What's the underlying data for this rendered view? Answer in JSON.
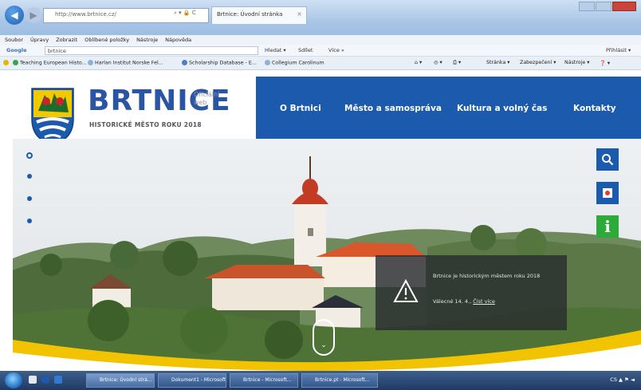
{
  "browser": {
    "address": "http://www.brtnice.cz/",
    "address_controls": "⌕ ▾ 🔒 C",
    "tab_title": "Brtnice: Úvodní stránka",
    "tab_close": "×",
    "menu": [
      "Soubor",
      "Úpravy",
      "Zobrazit",
      "Oblíbené položky",
      "Nástroje",
      "Nápověda"
    ],
    "google": {
      "logo": "Google",
      "query": "brtnice",
      "buttons": [
        "Hledat ▾",
        "Sdílet",
        "Více »"
      ],
      "signin": "Přihlásit ▾"
    },
    "favorites": [
      "Teaching European Histo...",
      "Harlan Institut Norske Fel...",
      "Scholarship Database - E...",
      "Collegium Carolinum"
    ],
    "commands": [
      "Stránka ▾",
      "Zabezpečení ▾",
      "Nástroje ▾"
    ]
  },
  "site": {
    "brand": "BRTNICE",
    "official": "Oficiální web",
    "tagline": "HISTORICKÉ MĚSTO ROKU 2018",
    "nav": [
      "O Brtnici",
      "Město a samospráva",
      "Kultura a volný čas",
      "Kontakty"
    ],
    "notice_text": "Brtnice je historickým městem roku 2018",
    "notice_date": "Válecné 14. 4.,",
    "notice_more": "Číst více",
    "side_buttons": [
      "search-icon",
      "web-icon",
      "info-icon"
    ]
  },
  "taskbar": {
    "items": [
      "Brtnice: Úvodní strá...",
      "Dokument1 - Microsoft...",
      "Brtnice - Microsoft...",
      "Brtnice.pt - Microsoft..."
    ],
    "clock": "CS ▲ ⚑ ◄"
  },
  "colors": {
    "brand_blue": "#1c5aad",
    "green_info": "#2eaa3a",
    "accent_yellow": "#f2c300"
  }
}
